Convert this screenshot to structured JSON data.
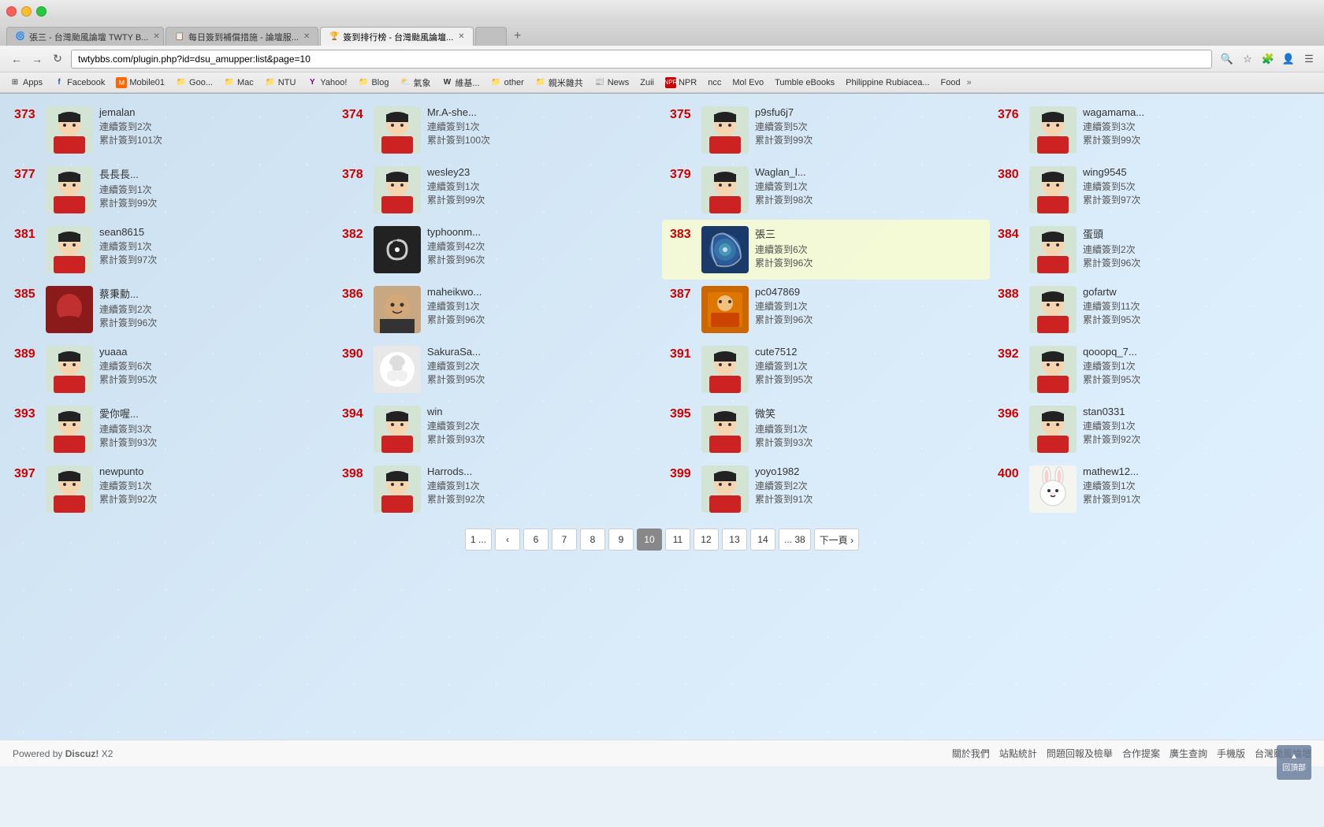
{
  "browser": {
    "tabs": [
      {
        "id": "tab1",
        "label": "張三 - 台灣颱風論壇 TWTY B...",
        "active": false,
        "icon": "🌀"
      },
      {
        "id": "tab2",
        "label": "每日簽到補償措施 - 論壇服...",
        "active": false,
        "icon": "📋"
      },
      {
        "id": "tab3",
        "label": "簽到排行榜 - 台灣颱風論壇...",
        "active": true,
        "icon": "🏆"
      },
      {
        "id": "tab4",
        "label": "",
        "active": false,
        "icon": ""
      }
    ],
    "url": "twtybbs.com/plugin.php?id=dsu_amupper:list&page=10",
    "bookmarks": [
      {
        "label": "Apps",
        "icon": "⊞"
      },
      {
        "label": "Facebook",
        "icon": "f",
        "color": "#3b5998"
      },
      {
        "label": "Mobile01",
        "icon": "M",
        "color": "#ff6600"
      },
      {
        "label": "Goo...",
        "icon": "G"
      },
      {
        "label": "Mac",
        "icon": "🍎"
      },
      {
        "label": "NTU",
        "icon": "📚"
      },
      {
        "label": "Yahoo!",
        "icon": "Y",
        "color": "#7b0099"
      },
      {
        "label": "Blog",
        "icon": "B"
      },
      {
        "label": "氣象",
        "icon": "⛅"
      },
      {
        "label": "維基...",
        "icon": "W"
      },
      {
        "label": "other",
        "icon": "📁"
      },
      {
        "label": "親米雜共",
        "icon": "📁"
      },
      {
        "label": "News",
        "icon": "📰"
      },
      {
        "label": "Zuii",
        "icon": "Z"
      },
      {
        "label": "NPR",
        "icon": "N"
      },
      {
        "label": "ncc",
        "icon": "N"
      },
      {
        "label": "Mol Evo",
        "icon": "🧬"
      },
      {
        "label": "Tumble eBooks",
        "icon": "📖"
      },
      {
        "label": "Philippine Rubiacea...",
        "icon": "🌿"
      },
      {
        "label": "Food",
        "icon": "🍱"
      }
    ]
  },
  "page": {
    "title": "簽到排行榜 - 台灣颱風論壇",
    "current_page": 10,
    "rankings": [
      {
        "rank": 373,
        "name": "jemalan",
        "streak": "連續簽到2次",
        "total": "累計簽到101次",
        "highlighted": false,
        "avatar_type": "default"
      },
      {
        "rank": 374,
        "name": "Mr.A-she...",
        "streak": "連續簽到1次",
        "total": "累計簽到100次",
        "highlighted": false,
        "avatar_type": "default"
      },
      {
        "rank": 375,
        "name": "p9sfu6j7",
        "streak": "連續簽到5次",
        "total": "累計簽到99次",
        "highlighted": false,
        "avatar_type": "default"
      },
      {
        "rank": 376,
        "name": "wagamama...",
        "streak": "連續簽到3次",
        "total": "累計簽到99次",
        "highlighted": false,
        "avatar_type": "default"
      },
      {
        "rank": 377,
        "name": "長長長...",
        "streak": "連續簽到1次",
        "total": "累計簽到99次",
        "highlighted": false,
        "avatar_type": "default"
      },
      {
        "rank": 378,
        "name": "wesley23",
        "streak": "連續簽到1次",
        "total": "累計簽到99次",
        "highlighted": false,
        "avatar_type": "default"
      },
      {
        "rank": 379,
        "name": "Waglan_l...",
        "streak": "連續簽到1次",
        "total": "累計簽到98次",
        "highlighted": false,
        "avatar_type": "default"
      },
      {
        "rank": 380,
        "name": "wing9545",
        "streak": "連續簽到5次",
        "total": "累計簽到97次",
        "highlighted": false,
        "avatar_type": "default"
      },
      {
        "rank": 381,
        "name": "sean8615",
        "streak": "連續簽到1次",
        "total": "累計簽到97次",
        "highlighted": false,
        "avatar_type": "default"
      },
      {
        "rank": 382,
        "name": "typhoonm...",
        "streak": "連續簽到42次",
        "total": "累計簽到96次",
        "highlighted": false,
        "avatar_type": "typhoon"
      },
      {
        "rank": 383,
        "name": "張三",
        "streak": "連續簽到6次",
        "total": "累計簽到96次",
        "highlighted": true,
        "avatar_type": "typhoon_photo"
      },
      {
        "rank": 384,
        "name": "蛋頭",
        "streak": "連續簽到2次",
        "total": "累計簽到96次",
        "highlighted": false,
        "avatar_type": "default"
      },
      {
        "rank": 385,
        "name": "蔡秉勳...",
        "streak": "連續簽到2次",
        "total": "累計簽到96次",
        "highlighted": false,
        "avatar_type": "photo_red"
      },
      {
        "rank": 386,
        "name": "maheikwo...",
        "streak": "連續簽到1次",
        "total": "累計簽到96次",
        "highlighted": false,
        "avatar_type": "photo_face"
      },
      {
        "rank": 387,
        "name": "pc047869",
        "streak": "連續簽到1次",
        "total": "累計簽到96次",
        "highlighted": false,
        "avatar_type": "photo_orange"
      },
      {
        "rank": 388,
        "name": "gofartw",
        "streak": "連續簽到11次",
        "total": "累計簽到95次",
        "highlighted": false,
        "avatar_type": "default"
      },
      {
        "rank": 389,
        "name": "yuaaa",
        "streak": "連續簽到6次",
        "total": "累計簽到95次",
        "highlighted": false,
        "avatar_type": "default"
      },
      {
        "rank": 390,
        "name": "SakuraSa...",
        "streak": "連續簽到2次",
        "total": "累計簽到95次",
        "highlighted": false,
        "avatar_type": "photo_white"
      },
      {
        "rank": 391,
        "name": "cute7512",
        "streak": "連續簽到1次",
        "total": "累計簽到95次",
        "highlighted": false,
        "avatar_type": "default"
      },
      {
        "rank": 392,
        "name": "qooopq_7...",
        "streak": "連續簽到1次",
        "total": "累計簽到95次",
        "highlighted": false,
        "avatar_type": "default"
      },
      {
        "rank": 393,
        "name": "愛你喔...",
        "streak": "連續簽到3次",
        "total": "累計簽到93次",
        "highlighted": false,
        "avatar_type": "default"
      },
      {
        "rank": 394,
        "name": "win",
        "streak": "連續簽到2次",
        "total": "累計簽到93次",
        "highlighted": false,
        "avatar_type": "default"
      },
      {
        "rank": 395,
        "name": "微笑",
        "streak": "連續簽到1次",
        "total": "累計簽到93次",
        "highlighted": false,
        "avatar_type": "default"
      },
      {
        "rank": 396,
        "name": "stan0331",
        "streak": "連續簽到1次",
        "total": "累計簽到92次",
        "highlighted": false,
        "avatar_type": "default"
      },
      {
        "rank": 397,
        "name": "newpunto",
        "streak": "連續簽到1次",
        "total": "累計簽到92次",
        "highlighted": false,
        "avatar_type": "default"
      },
      {
        "rank": 398,
        "name": "Harrods...",
        "streak": "連續簽到1次",
        "total": "累計簽到92次",
        "highlighted": false,
        "avatar_type": "default"
      },
      {
        "rank": 399,
        "name": "yoyo1982",
        "streak": "連續簽到2次",
        "total": "累計簽到91次",
        "highlighted": false,
        "avatar_type": "default"
      },
      {
        "rank": 400,
        "name": "mathew12...",
        "streak": "連續簽到1次",
        "total": "累計簽到91次",
        "highlighted": false,
        "avatar_type": "bunny"
      }
    ],
    "pagination": {
      "pages": [
        "1 ...",
        "‹",
        "6",
        "7",
        "8",
        "9",
        "10",
        "11",
        "12",
        "13",
        "14",
        "... 38",
        "下一頁 ›"
      ],
      "current": "10"
    },
    "footer": {
      "powered_by": "Powered by Discuz! X2",
      "links": [
        "關於我們",
        "站點統計",
        "問題回報及檢舉",
        "合作提案",
        "廣生查詢",
        "手機版",
        "台灣颱風論壇"
      ]
    }
  },
  "back_to_top_label": "回頂部"
}
